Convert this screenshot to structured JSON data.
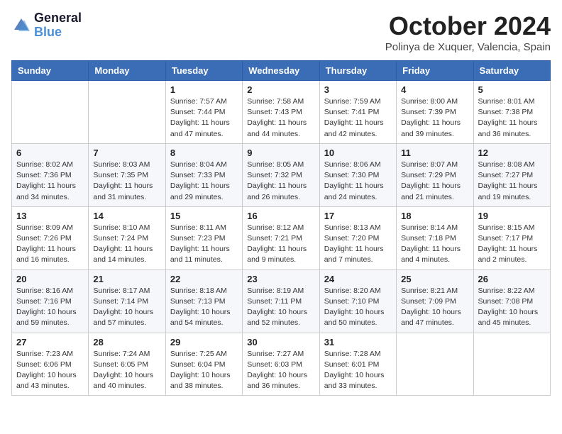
{
  "header": {
    "logo_line1": "General",
    "logo_line2": "Blue",
    "month_title": "October 2024",
    "location": "Polinya de Xuquer, Valencia, Spain"
  },
  "weekdays": [
    "Sunday",
    "Monday",
    "Tuesday",
    "Wednesday",
    "Thursday",
    "Friday",
    "Saturday"
  ],
  "weeks": [
    [
      {
        "day": null,
        "info": null
      },
      {
        "day": null,
        "info": null
      },
      {
        "day": "1",
        "info": "Sunrise: 7:57 AM\nSunset: 7:44 PM\nDaylight: 11 hours and 47 minutes."
      },
      {
        "day": "2",
        "info": "Sunrise: 7:58 AM\nSunset: 7:43 PM\nDaylight: 11 hours and 44 minutes."
      },
      {
        "day": "3",
        "info": "Sunrise: 7:59 AM\nSunset: 7:41 PM\nDaylight: 11 hours and 42 minutes."
      },
      {
        "day": "4",
        "info": "Sunrise: 8:00 AM\nSunset: 7:39 PM\nDaylight: 11 hours and 39 minutes."
      },
      {
        "day": "5",
        "info": "Sunrise: 8:01 AM\nSunset: 7:38 PM\nDaylight: 11 hours and 36 minutes."
      }
    ],
    [
      {
        "day": "6",
        "info": "Sunrise: 8:02 AM\nSunset: 7:36 PM\nDaylight: 11 hours and 34 minutes."
      },
      {
        "day": "7",
        "info": "Sunrise: 8:03 AM\nSunset: 7:35 PM\nDaylight: 11 hours and 31 minutes."
      },
      {
        "day": "8",
        "info": "Sunrise: 8:04 AM\nSunset: 7:33 PM\nDaylight: 11 hours and 29 minutes."
      },
      {
        "day": "9",
        "info": "Sunrise: 8:05 AM\nSunset: 7:32 PM\nDaylight: 11 hours and 26 minutes."
      },
      {
        "day": "10",
        "info": "Sunrise: 8:06 AM\nSunset: 7:30 PM\nDaylight: 11 hours and 24 minutes."
      },
      {
        "day": "11",
        "info": "Sunrise: 8:07 AM\nSunset: 7:29 PM\nDaylight: 11 hours and 21 minutes."
      },
      {
        "day": "12",
        "info": "Sunrise: 8:08 AM\nSunset: 7:27 PM\nDaylight: 11 hours and 19 minutes."
      }
    ],
    [
      {
        "day": "13",
        "info": "Sunrise: 8:09 AM\nSunset: 7:26 PM\nDaylight: 11 hours and 16 minutes."
      },
      {
        "day": "14",
        "info": "Sunrise: 8:10 AM\nSunset: 7:24 PM\nDaylight: 11 hours and 14 minutes."
      },
      {
        "day": "15",
        "info": "Sunrise: 8:11 AM\nSunset: 7:23 PM\nDaylight: 11 hours and 11 minutes."
      },
      {
        "day": "16",
        "info": "Sunrise: 8:12 AM\nSunset: 7:21 PM\nDaylight: 11 hours and 9 minutes."
      },
      {
        "day": "17",
        "info": "Sunrise: 8:13 AM\nSunset: 7:20 PM\nDaylight: 11 hours and 7 minutes."
      },
      {
        "day": "18",
        "info": "Sunrise: 8:14 AM\nSunset: 7:18 PM\nDaylight: 11 hours and 4 minutes."
      },
      {
        "day": "19",
        "info": "Sunrise: 8:15 AM\nSunset: 7:17 PM\nDaylight: 11 hours and 2 minutes."
      }
    ],
    [
      {
        "day": "20",
        "info": "Sunrise: 8:16 AM\nSunset: 7:16 PM\nDaylight: 10 hours and 59 minutes."
      },
      {
        "day": "21",
        "info": "Sunrise: 8:17 AM\nSunset: 7:14 PM\nDaylight: 10 hours and 57 minutes."
      },
      {
        "day": "22",
        "info": "Sunrise: 8:18 AM\nSunset: 7:13 PM\nDaylight: 10 hours and 54 minutes."
      },
      {
        "day": "23",
        "info": "Sunrise: 8:19 AM\nSunset: 7:11 PM\nDaylight: 10 hours and 52 minutes."
      },
      {
        "day": "24",
        "info": "Sunrise: 8:20 AM\nSunset: 7:10 PM\nDaylight: 10 hours and 50 minutes."
      },
      {
        "day": "25",
        "info": "Sunrise: 8:21 AM\nSunset: 7:09 PM\nDaylight: 10 hours and 47 minutes."
      },
      {
        "day": "26",
        "info": "Sunrise: 8:22 AM\nSunset: 7:08 PM\nDaylight: 10 hours and 45 minutes."
      }
    ],
    [
      {
        "day": "27",
        "info": "Sunrise: 7:23 AM\nSunset: 6:06 PM\nDaylight: 10 hours and 43 minutes."
      },
      {
        "day": "28",
        "info": "Sunrise: 7:24 AM\nSunset: 6:05 PM\nDaylight: 10 hours and 40 minutes."
      },
      {
        "day": "29",
        "info": "Sunrise: 7:25 AM\nSunset: 6:04 PM\nDaylight: 10 hours and 38 minutes."
      },
      {
        "day": "30",
        "info": "Sunrise: 7:27 AM\nSunset: 6:03 PM\nDaylight: 10 hours and 36 minutes."
      },
      {
        "day": "31",
        "info": "Sunrise: 7:28 AM\nSunset: 6:01 PM\nDaylight: 10 hours and 33 minutes."
      },
      {
        "day": null,
        "info": null
      },
      {
        "day": null,
        "info": null
      }
    ]
  ]
}
